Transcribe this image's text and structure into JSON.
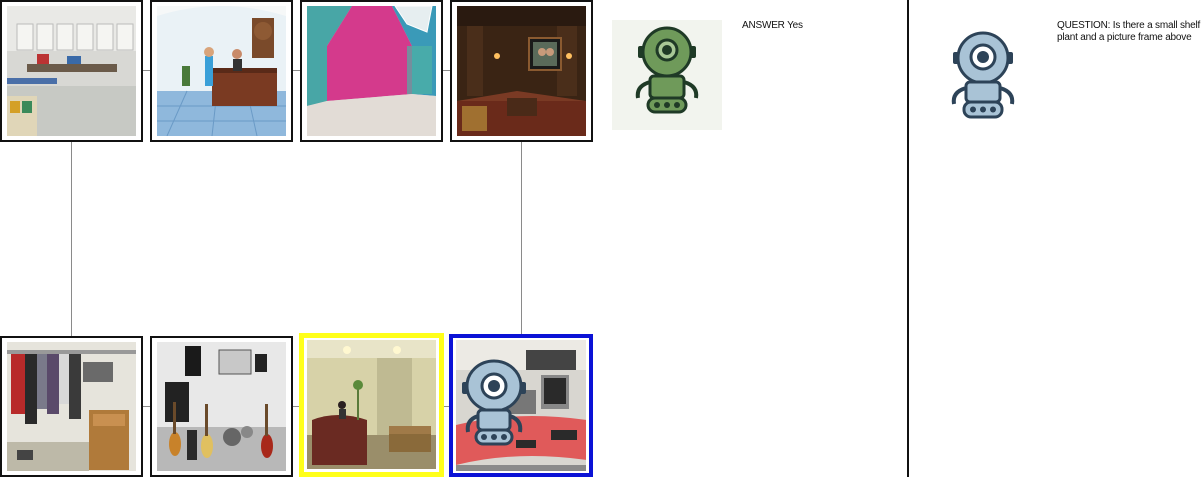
{
  "answer_panel": {
    "text": "ANSWER Yes",
    "avatar_icon": "robot-green-icon"
  },
  "question_panel": {
    "text": "QUESTION: Is there a small shelf plant and a picture frame above",
    "avatar_icon": "robot-blue-icon"
  },
  "grid": {
    "top_row": [
      {
        "scene": "craft-room"
      },
      {
        "scene": "lobby-reception"
      },
      {
        "scene": "pink-attic-room"
      },
      {
        "scene": "home-theater"
      }
    ],
    "bottom_row": [
      {
        "scene": "closet"
      },
      {
        "scene": "music-room"
      },
      {
        "scene": "reception-desk",
        "highlight": "yellow"
      },
      {
        "scene": "office-computers",
        "highlight": "blue",
        "overlay_icon": "robot-blue-icon"
      }
    ]
  },
  "colors": {
    "highlight_yellow": "#ffff1a",
    "highlight_blue": "#0b12d6",
    "robot_green": "#6f9a5a",
    "robot_blue": "#a9c3d6"
  }
}
